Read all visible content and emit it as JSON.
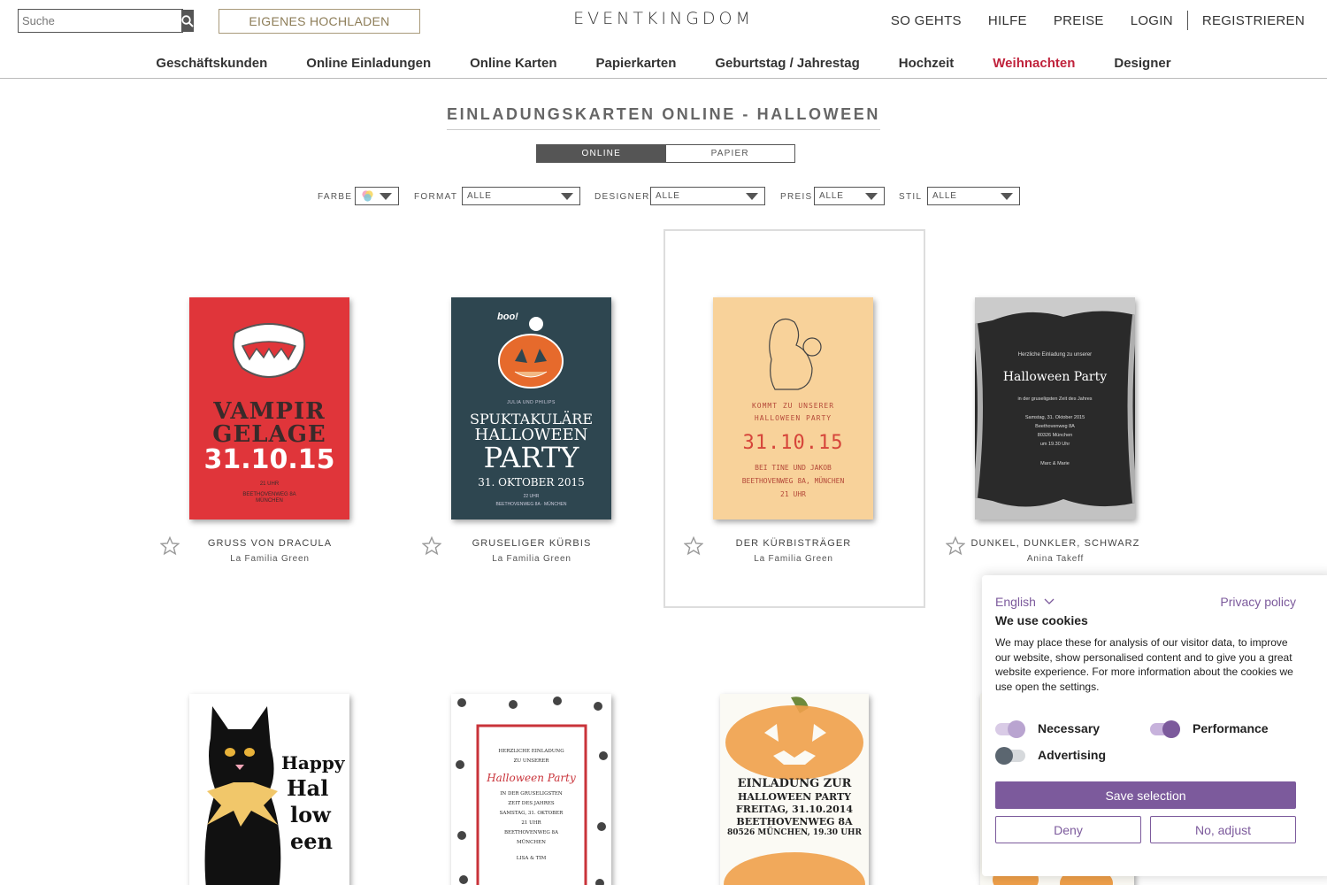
{
  "header": {
    "search_placeholder": "Suche",
    "upload_label": "EIGENES HOCHLADEN",
    "logo": "EVENTKINGDOM",
    "top_nav": [
      "SO GEHTS",
      "HILFE",
      "PREISE",
      "LOGIN",
      "REGISTRIEREN"
    ]
  },
  "main_nav": {
    "items": [
      "Geschäftskunden",
      "Online Einladungen",
      "Online Karten",
      "Papierkarten",
      "Geburtstag / Jahrestag",
      "Hochzeit",
      "Weihnachten",
      "Designer"
    ],
    "active": "Weihnachten",
    "active_color": "#c0233c"
  },
  "page": {
    "title": "EINLADUNGSKARTEN ONLINE - HALLOWEEN",
    "toggle": {
      "online": "ONLINE",
      "paper": "PAPIER",
      "selected": "ONLINE"
    }
  },
  "filters": {
    "farbe_label": "FARBE",
    "format_label": "FORMAT",
    "format_value": "ALLE",
    "designer_label": "DESIGNER",
    "designer_value": "ALLE",
    "preis_label": "PREIS",
    "preis_value": "ALLE",
    "stil_label": "STIL",
    "stil_value": "ALLE"
  },
  "cards": [
    {
      "name": "GRUSS VON DRACULA",
      "designer": "La Familia Green",
      "bg": "#e0353a",
      "lines": [
        "VAMPIR",
        "GELAGE",
        "31.10.15",
        "21 UHR",
        "BEETHOVENWEG 8A",
        "MÜNCHEN"
      ]
    },
    {
      "name": "GRUSELIGER KÜRBIS",
      "designer": "La Familia Green",
      "bg": "#2e4650",
      "lines": [
        "boo!",
        "JULIA UND PHILIPS",
        "SPUKTAKULÄRE",
        "HALLOWEEN",
        "PARTY",
        "31. OKTOBER 2015",
        "22 UHR",
        "BEETHOVENWEG 8A · MÜNCHEN"
      ]
    },
    {
      "name": "DER KÜRBISTRÄGER",
      "designer": "La Familia Green",
      "bg": "#f8d29a",
      "lines": [
        "KOMMT ZU UNSERER",
        "HALLOWEEN PARTY",
        "31.10.15",
        "BEI TINE UND JAKOB",
        "BEETHOVENWEG 8A, MÜNCHEN",
        "21 UHR"
      ]
    },
    {
      "name": "DUNKEL, DUNKLER, SCHWARZ",
      "designer": "Anina Takeff",
      "bg": "#2a2a2a",
      "lines": [
        "Herzliche Einladung zu unserer",
        "Halloween Party",
        "in der gruseligsten Zeit des Jahres",
        "Samstag, 31. Oktober 2015",
        "Beethovenweg 8A",
        "80326 München",
        "um 19.30 Uhr",
        "Marc & Marie"
      ]
    },
    {
      "name": "",
      "designer": "",
      "bg": "#ffffff",
      "lines": [
        "Happy",
        "Hal",
        "low",
        "een"
      ]
    },
    {
      "name": "",
      "designer": "",
      "bg": "#ffffff",
      "lines": [
        "HERZLICHE EINLADUNG",
        "ZU UNSERER",
        "Halloween Party",
        "IN DER GRUSELIGSTEN",
        "ZEIT DES JAHRES",
        "SAMSTAG, 31. OKTOBER",
        "21 UHR",
        "BEETHOVENWEG 8A",
        "MÜNCHEN",
        "LISA & TIM"
      ]
    },
    {
      "name": "",
      "designer": "",
      "bg": "#fbfaf4",
      "lines": [
        "EINLADUNG ZUR",
        "HALLOWEEN PARTY",
        "FREITAG, 31.10.2014",
        "BEETHOVENWEG 8A",
        "80526 MÜNCHEN, 19.30 UHR"
      ]
    }
  ],
  "cookie": {
    "language": "English",
    "privacy_link": "Privacy policy",
    "title": "We use cookies",
    "text": "We may place these for analysis of our visitor data, to improve our website, show personalised content and to give you a great website experience. For more information about the cookies we use open the settings.",
    "toggles": [
      {
        "label": "Necessary",
        "on": true
      },
      {
        "label": "Performance",
        "on": true
      },
      {
        "label": "Advertising",
        "on": false
      }
    ],
    "save_label": "Save selection",
    "deny_label": "Deny",
    "adjust_label": "No, adjust",
    "accent_color": "#7c5a9c"
  }
}
